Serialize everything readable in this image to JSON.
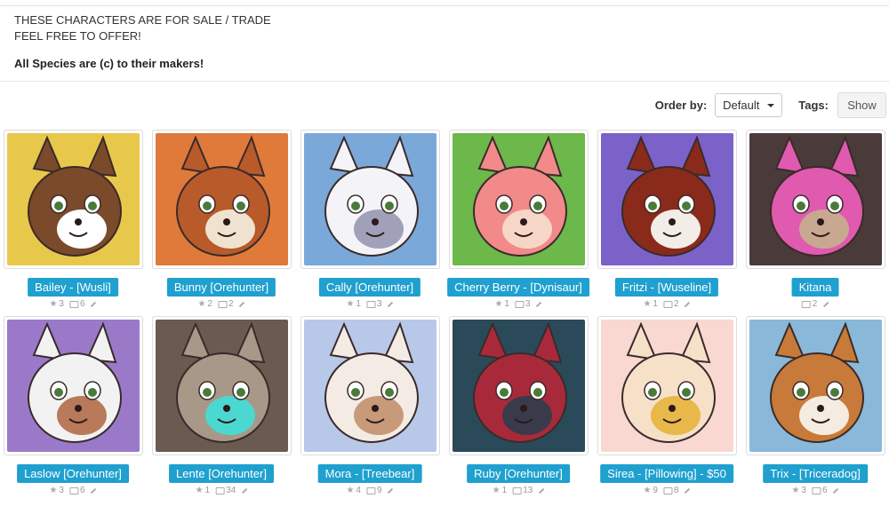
{
  "intro": {
    "line1": "THESE CHARACTERS ARE FOR SALE / TRADE",
    "line2": "FEEL FREE TO OFFER!",
    "line3": "All Species are (c) to their makers!"
  },
  "toolbar": {
    "order_label": "Order by:",
    "order_value": "Default",
    "tags_label": "Tags:",
    "show_label": "Show"
  },
  "characters": [
    {
      "name": "Bailey - [Wusli]",
      "favs": "3",
      "images": "6",
      "colors": [
        "#e8c84a",
        "#7a4a2a",
        "#ffffff"
      ]
    },
    {
      "name": "Bunny [Orehunter]",
      "favs": "2",
      "images": "2",
      "colors": [
        "#e07a3a",
        "#b85a2a",
        "#efe3cf"
      ]
    },
    {
      "name": "Cally [Orehunter]",
      "favs": "1",
      "images": "3",
      "colors": [
        "#7aa8d8",
        "#f4f4f8",
        "#a0a0b8"
      ]
    },
    {
      "name": "Cherry Berry - [Dynisaur]",
      "favs": "1",
      "images": "3",
      "colors": [
        "#6cb84a",
        "#f28a8a",
        "#f6d6c6"
      ]
    },
    {
      "name": "Fritzi - [Wuseline]",
      "favs": "1",
      "images": "2",
      "colors": [
        "#7a62c8",
        "#8a2a1a",
        "#f2ede6"
      ]
    },
    {
      "name": "Kitana",
      "favs": "",
      "images": "2",
      "colors": [
        "#4a3a3a",
        "#e05ab0",
        "#c8a890"
      ]
    },
    {
      "name": "Laslow [Orehunter]",
      "favs": "3",
      "images": "6",
      "colors": [
        "#9a7ac8",
        "#f2f2f2",
        "#b87a5a"
      ]
    },
    {
      "name": "Lente [Orehunter]",
      "favs": "1",
      "images": "34",
      "colors": [
        "#6a5a50",
        "#a89888",
        "#4ad8d0"
      ]
    },
    {
      "name": "Mora - [Treebear]",
      "favs": "4",
      "images": "9",
      "colors": [
        "#b8c8e8",
        "#f4ece4",
        "#c89a7a"
      ]
    },
    {
      "name": "Ruby [Orehunter]",
      "favs": "1",
      "images": "13",
      "colors": [
        "#2a4a5a",
        "#a82a3a",
        "#3a3a4a"
      ]
    },
    {
      "name": "Sirea - [Pillowing] - $50",
      "favs": "9",
      "images": "8",
      "colors": [
        "#f8d8d0",
        "#f6e0c8",
        "#e8b84a"
      ]
    },
    {
      "name": "Trix - [Triceradog]",
      "favs": "3",
      "images": "6",
      "colors": [
        "#8ab8d8",
        "#c87a3a",
        "#f4ece0"
      ]
    }
  ]
}
